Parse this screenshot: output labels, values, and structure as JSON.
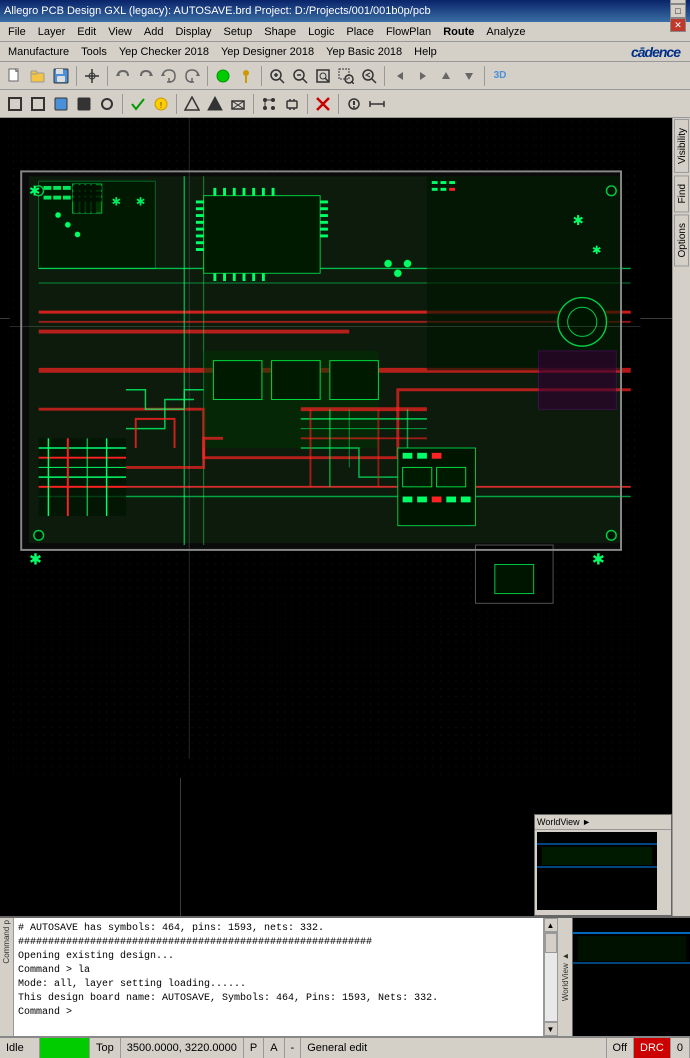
{
  "titlebar": {
    "text": "Allegro PCB Design GXL (legacy): AUTOSAVE.brd  Project: D:/Projects/001/001b0p/pcb",
    "minimize": "─",
    "maximize": "□",
    "close": "✕"
  },
  "menubar1": {
    "items": [
      "File",
      "Layer",
      "Edit",
      "View",
      "Add",
      "Display",
      "Setup",
      "Shape",
      "Logic",
      "Place",
      "FlowPlan",
      "Route",
      "Analyze"
    ]
  },
  "menubar2": {
    "items": [
      "Manufacture",
      "Tools",
      "Yep Checker 2018",
      "Yep Designer 2018",
      "Yep Basic 2018",
      "Help"
    ],
    "logo": "cādence"
  },
  "sidepanel": {
    "tabs": [
      "Visibility",
      "Find",
      "Options"
    ]
  },
  "worldview": {
    "label": "WorldView ►"
  },
  "console": {
    "lines": [
      "# AUTOSAVE has symbols: 464, pins: 1593, nets: 332.",
      "###########################################################",
      "Opening existing design...",
      "Command > la",
      "Mode: all, layer setting loading......",
      "This design board name: AUTOSAVE, Symbols: 464, Pins: 1593, Nets: 332.",
      "Command >"
    ],
    "side_label": "Command p"
  },
  "statusbar": {
    "idle": "Idle",
    "layer": "Top",
    "coords": "3500.0000, 3220.0000",
    "p_indicator": "P",
    "a_indicator": "A",
    "dash": "-",
    "mode": "General edit",
    "off": "Off",
    "drc": "DRC",
    "number": "0"
  },
  "toolbar1": {
    "buttons": [
      "new",
      "open",
      "save",
      "sep",
      "snap",
      "sep",
      "undo",
      "redo",
      "undo2",
      "redo2",
      "sep",
      "ratsnest",
      "pin",
      "sep",
      "zoom-in",
      "zoom-out",
      "zoom-fit",
      "zoom-sel",
      "zoom-prev",
      "sep",
      "pan-l",
      "pan-r",
      "pan-u",
      "pan-d",
      "sep",
      "3d"
    ]
  },
  "toolbar2": {
    "buttons": [
      "outline",
      "keepout",
      "route",
      "trace",
      "via",
      "sep",
      "check",
      "drc",
      "sep",
      "shape",
      "fill",
      "cutout",
      "sep",
      "sel-net",
      "sel-comp",
      "sep",
      "delete"
    ]
  }
}
